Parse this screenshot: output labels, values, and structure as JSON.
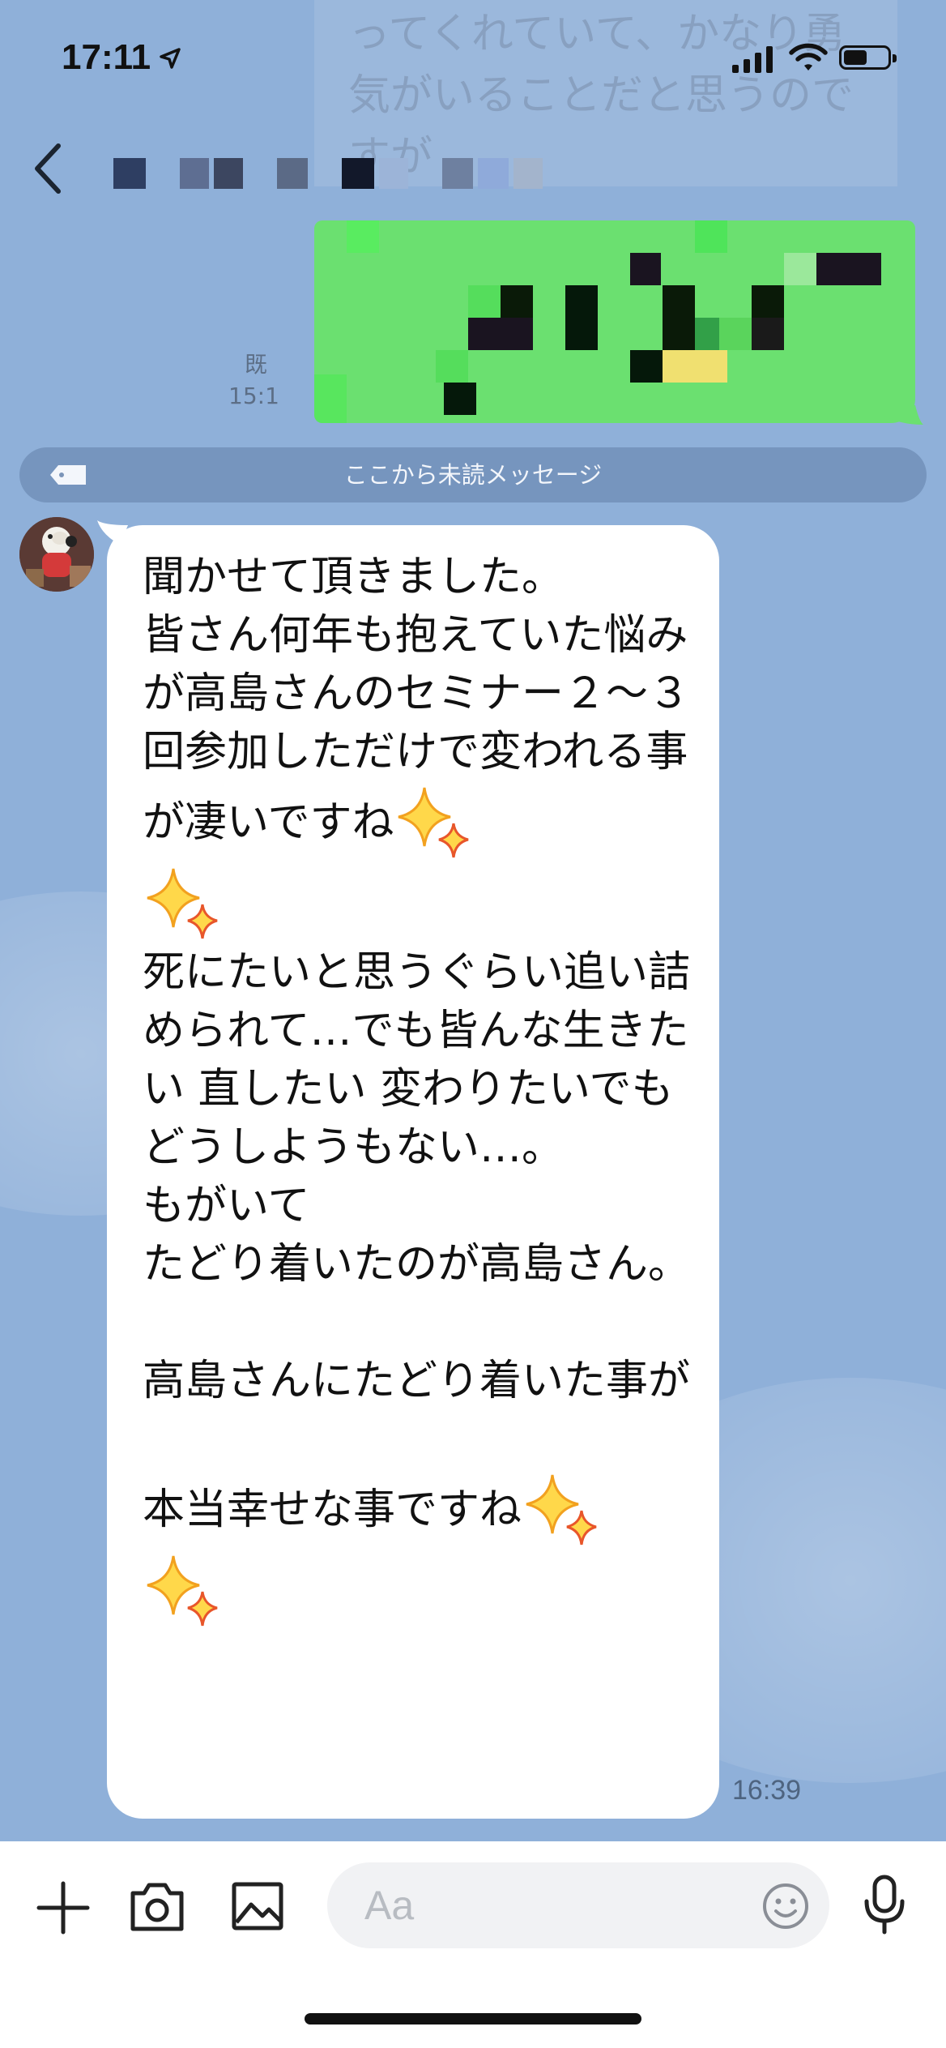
{
  "status_bar": {
    "time": "17:11"
  },
  "header": {
    "back_icon": "chevron-left-icon",
    "contact_name": ""
  },
  "background_text": "ってくれていて、かなり勇\n気がいることだと思うので\nすが",
  "outgoing": {
    "read_label": "既",
    "time": "15:1"
  },
  "unread_divider": {
    "label": "ここから未読メッセージ"
  },
  "incoming": {
    "segments": [
      "聞かせて頂きました。\n皆さん何年も抱えていた悩みが高島さんのセミナー２〜３回参加しただけで変われる事が凄いですね",
      "\n",
      "\n死にたいと思うぐらい追い詰められて…でも皆んな生きたい 直したい 変わりたいでもどうしようもない…。\nもがいて\nたどり着いたのが高島さん。\n\n高島さんにたどり着いた事が\n\n本当幸せな事ですね",
      "\n"
    ],
    "emoji": "sparkles",
    "time": "16:39"
  },
  "input_bar": {
    "placeholder": "Aa",
    "icons": [
      "plus-icon",
      "camera-icon",
      "image-icon",
      "emoji-icon",
      "microphone-icon"
    ]
  },
  "colors": {
    "background": "#8FB0D9",
    "outgoing_bubble": "#6BE070",
    "incoming_bubble": "#FFFFFF"
  }
}
